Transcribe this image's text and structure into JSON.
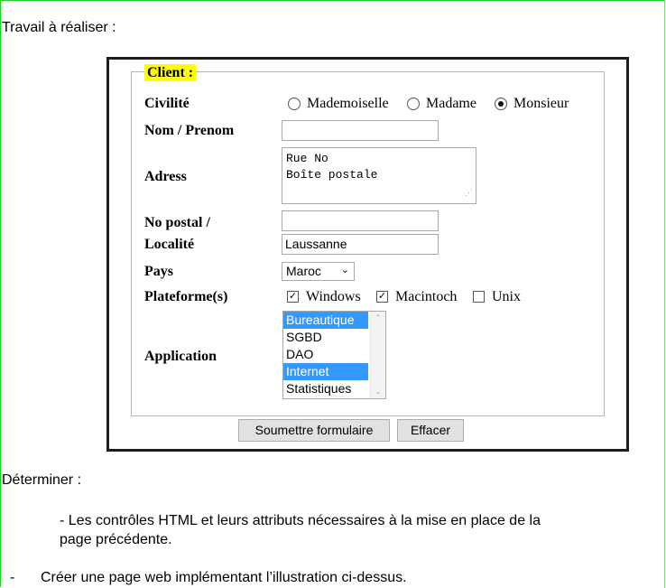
{
  "heading": "Travail à réaliser :",
  "form": {
    "legend": "Client :",
    "labels": {
      "civilite": "Civilité",
      "nom": "Nom / Prenom",
      "adress": "Adress",
      "postal_line1": "No postal /",
      "postal_line2": "Localité",
      "pays": "Pays",
      "plateformes": "Plateforme(s)",
      "application": "Application"
    },
    "civilite_options": [
      "Mademoiselle",
      "Madame",
      "Monsieur"
    ],
    "civilite_selected": "Monsieur",
    "nom_value": "",
    "adress_lines": [
      "Rue No",
      "Boîte postale"
    ],
    "postal_value": "",
    "localite_value": "Laussanne",
    "pays_selected": "Maroc",
    "plateformes": [
      {
        "label": "Windows",
        "checked": true
      },
      {
        "label": "Macintoch",
        "checked": true
      },
      {
        "label": "Unix",
        "checked": false
      }
    ],
    "applications": [
      {
        "label": "Bureautique",
        "selected": true
      },
      {
        "label": "SGBD",
        "selected": false
      },
      {
        "label": "DAO",
        "selected": false
      },
      {
        "label": "Internet",
        "selected": true
      },
      {
        "label": "Statistiques",
        "selected": false
      }
    ],
    "submit_label": "Soumettre formulaire",
    "reset_label": "Effacer"
  },
  "determiner": "Déterminer :",
  "bullet1_line1": "- Les contrôles HTML et  leurs attributs nécessaires à la mise en place de la",
  "bullet1_line2": "page précédente.",
  "bullet2_dash": "-",
  "bullet2": "Créer une page web implémentant l’illustration ci-dessus.",
  "colors": {
    "legend_bg": "#ffff00",
    "selection": "#3399ff",
    "page_border": "#22cc22"
  }
}
